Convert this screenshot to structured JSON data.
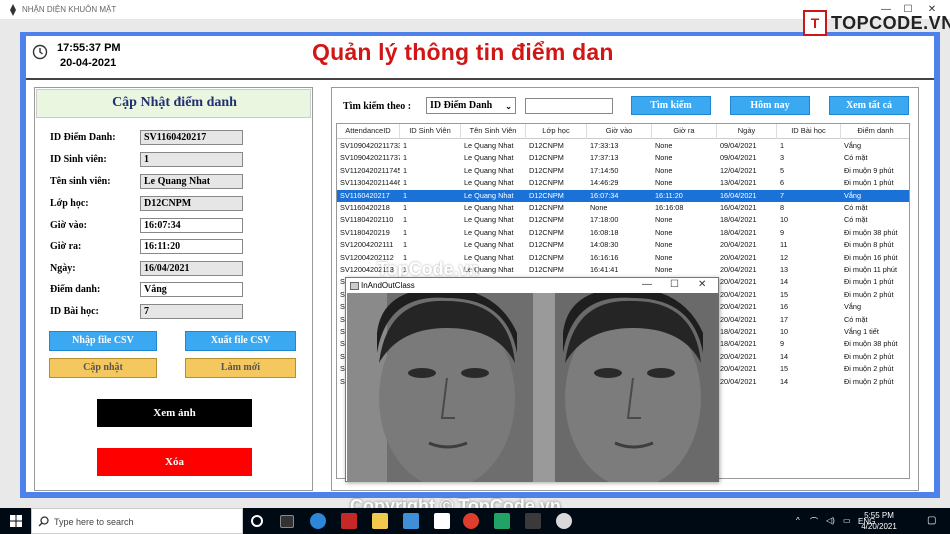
{
  "window": {
    "title": "NHẬN DIỆN KHUÔN MẶT",
    "minimize": "—",
    "maximize": "☐",
    "close": "✕"
  },
  "brand": {
    "mark": "T",
    "text": "TOPCODE.VN"
  },
  "header": {
    "time": "17:55:37 PM",
    "date": "20-04-2021",
    "title": "Quản lý thông tin điểm dan"
  },
  "form": {
    "title": "Cập Nhật điểm danh",
    "fields": [
      {
        "label": "ID Điểm Danh:",
        "value": "SV1160420217",
        "readonly": true
      },
      {
        "label": "ID Sinh viên:",
        "value": "1",
        "readonly": true
      },
      {
        "label": "Tên sinh viên:",
        "value": "Le Quang Nhat",
        "readonly": true
      },
      {
        "label": "Lớp học:",
        "value": "D12CNPM",
        "readonly": true
      },
      {
        "label": "Giờ vào:",
        "value": "16:07:34",
        "readonly": false
      },
      {
        "label": "Giờ ra:",
        "value": "16:11:20",
        "readonly": false
      },
      {
        "label": "Ngày:",
        "value": "16/04/2021",
        "readonly": true
      },
      {
        "label": "Điểm danh:",
        "value": "Vắng",
        "readonly": false
      },
      {
        "label": "ID Bài học:",
        "value": "7",
        "readonly": true
      }
    ],
    "buttons": {
      "import": "Nhập file CSV",
      "export": "Xuất file CSV",
      "update": "Cập nhật",
      "refresh": "Làm mới",
      "view_image": "Xem ảnh",
      "delete": "Xóa"
    }
  },
  "search": {
    "label": "Tìm kiếm theo :",
    "selected": "ID Điểm Danh",
    "value": "",
    "btn_search": "Tìm kiếm",
    "btn_today": "Hôm nay",
    "btn_all": "Xem tất cả"
  },
  "table": {
    "columns": [
      "AttendanceID",
      "ID Sinh Viên",
      "Tên Sinh Viên",
      "Lớp học",
      "Giờ vào",
      "Giờ ra",
      "Ngày",
      "ID Bài học",
      "Điểm danh"
    ],
    "rows": [
      [
        "SV1090420211733",
        "1",
        "Le Quang Nhat",
        "D12CNPM",
        "17:33:13",
        "None",
        "09/04/2021",
        "1",
        "Vắng"
      ],
      [
        "SV1090420211737",
        "1",
        "Le Quang Nhat",
        "D12CNPM",
        "17:37:13",
        "None",
        "09/04/2021",
        "3",
        "Có mặt"
      ],
      [
        "SV1120420211745",
        "1",
        "Le Quang Nhat",
        "D12CNPM",
        "17:14:50",
        "None",
        "12/04/2021",
        "5",
        "Đi muộn 9 phút"
      ],
      [
        "SV1130420211446",
        "1",
        "Le Quang Nhat",
        "D12CNPM",
        "14:46:29",
        "None",
        "13/04/2021",
        "6",
        "Đi muộn 1 phút"
      ],
      [
        "SV1160420217",
        "1",
        "Le Quang Nhat",
        "D12CNPM",
        "16:07:34",
        "16:11:20",
        "16/04/2021",
        "7",
        "Vắng"
      ],
      [
        "SV1160420218",
        "1",
        "Le Quang Nhat",
        "D12CNPM",
        "None",
        "16:16:08",
        "16/04/2021",
        "8",
        "Có mặt"
      ],
      [
        "SV1180420211​0",
        "1",
        "Le Quang Nhat",
        "D12CNPM",
        "17:18:00",
        "None",
        "18/04/2021",
        "10",
        "Có mặt"
      ],
      [
        "SV1180420219",
        "1",
        "Le Quang Nhat",
        "D12CNPM",
        "16:08:18",
        "None",
        "18/04/2021",
        "9",
        "Đi muộn 38 phút"
      ],
      [
        "SV120042021​11",
        "1",
        "Le Quang Nhat",
        "D12CNPM",
        "14:08:30",
        "None",
        "20/04/2021",
        "11",
        "Đi muộn 8 phút"
      ],
      [
        "SV120042021​12",
        "1",
        "Le Quang Nhat",
        "D12CNPM",
        "16:16:16",
        "None",
        "20/04/2021",
        "12",
        "Đi muộn 16 phút"
      ],
      [
        "SV120042021​13",
        "1",
        "Le Quang Nhat",
        "D12CNPM",
        "16:41:41",
        "None",
        "20/04/2021",
        "13",
        "Đi muộn 11 phút"
      ],
      [
        "SV",
        "",
        "",
        "",
        "",
        "",
        "20/04/2021",
        "14",
        "Đi muộn 1 phút"
      ],
      [
        "SV",
        "",
        "",
        "",
        "",
        "",
        "20/04/2021",
        "15",
        "Đi muộn 2 phút"
      ],
      [
        "SV",
        "",
        "",
        "",
        "",
        "",
        "20/04/2021",
        "16",
        "Vắng"
      ],
      [
        "SV",
        "",
        "",
        "",
        "",
        "",
        "20/04/2021",
        "17",
        "Có mặt"
      ],
      [
        "SV",
        "",
        "",
        "",
        "",
        "",
        "18/04/2021",
        "10",
        "Vắng 1 tiết"
      ],
      [
        "SV",
        "",
        "",
        "",
        "",
        "",
        "18/04/2021",
        "9",
        "Đi muộn 38 phút"
      ],
      [
        "SV",
        "",
        "",
        "",
        "",
        "",
        "20/04/2021",
        "14",
        "Đi muộn 2 phút"
      ],
      [
        "SV",
        "",
        "",
        "",
        "",
        "",
        "20/04/2021",
        "15",
        "Đi muộn 2 phút"
      ],
      [
        "SV",
        "",
        "",
        "",
        "",
        "",
        "20/04/2021",
        "14",
        "Đi muộn 2 phút"
      ]
    ],
    "selected_row": 4
  },
  "camera_window": {
    "title": "InAndOutClass",
    "minimize": "—",
    "maximize": "☐",
    "close": "✕"
  },
  "watermarks": {
    "center": "TopCode.vn",
    "bottom": "Copyright © TopCode.vn"
  },
  "taskbar": {
    "search_placeholder": "Type here to search",
    "time": "5:55 PM",
    "date": "4/20/2021",
    "lang": "ENG"
  },
  "colors": {
    "accent": "#4e82ea",
    "title_red": "#d11616",
    "selected_row": "#1a72d8",
    "btn_blue": "#3aa9f2",
    "btn_yellow": "#f4c75f"
  }
}
